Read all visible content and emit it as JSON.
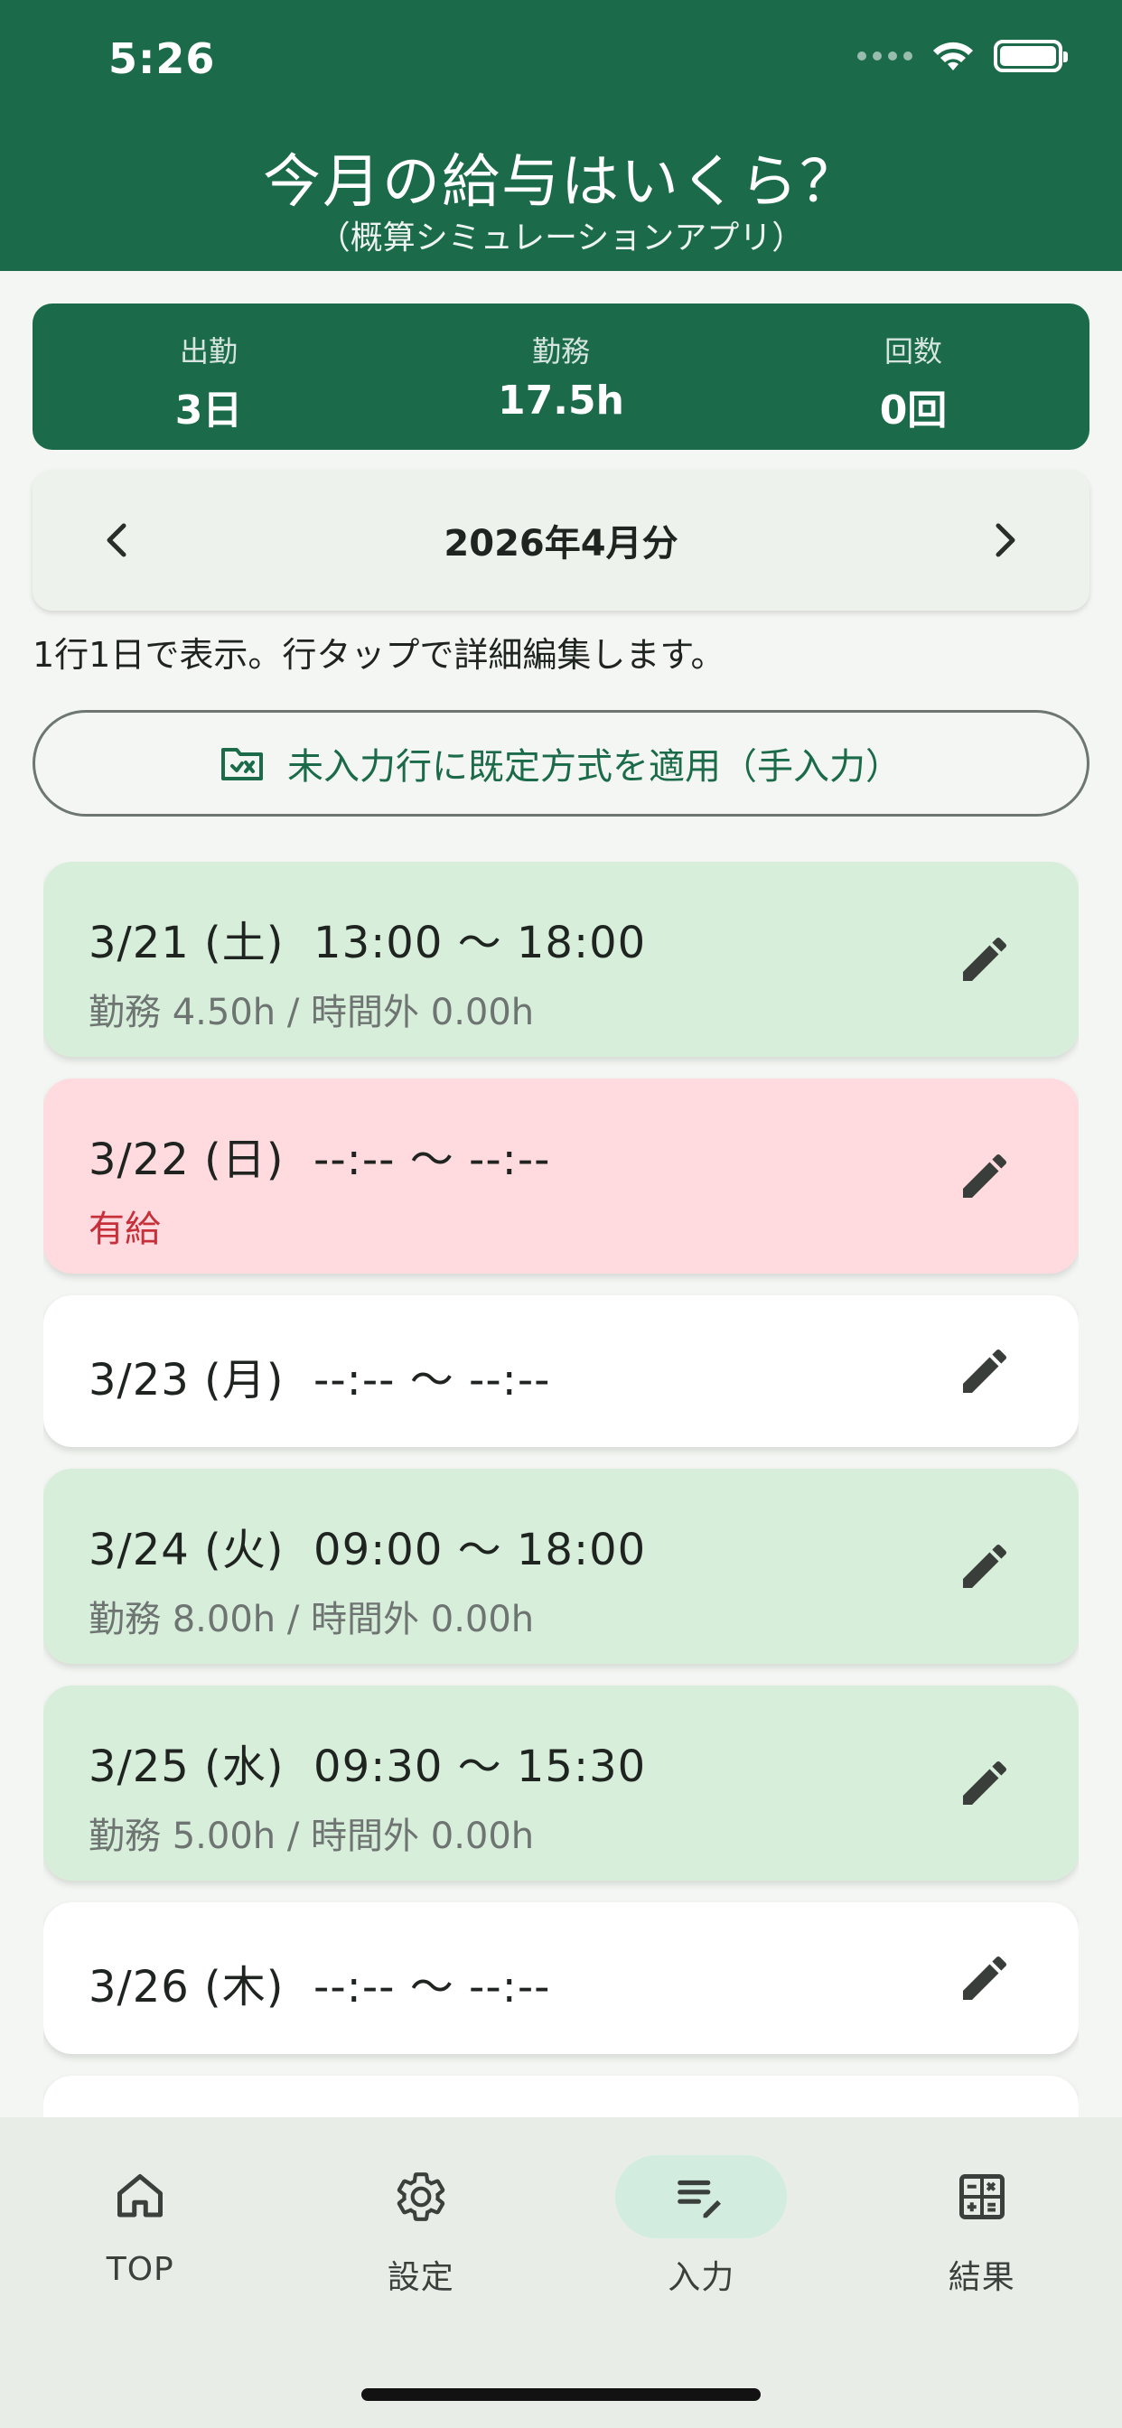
{
  "status": {
    "time": "5:26"
  },
  "header": {
    "title": "今月の給与はいくら？",
    "subtitle": "（概算シミュレーションアプリ）"
  },
  "summary": [
    {
      "label": "出勤",
      "value": "3日"
    },
    {
      "label": "勤務",
      "value": "17.5h"
    },
    {
      "label": "回数",
      "value": "0回"
    }
  ],
  "month_selector": {
    "label": "2026年4月分"
  },
  "hint": "1行1日で表示。行タップで詳細編集します。",
  "apply_button": {
    "label": "未入力行に既定方式を適用（手入力）",
    "icon": "folder-check-icon"
  },
  "days": [
    {
      "date": "3/21 (土)",
      "time": "13:00 〜 18:00",
      "detail": "勤務 4.50h / 時間外 0.00h",
      "status": "worked"
    },
    {
      "date": "3/22 (日)",
      "time": "--:-- 〜 --:--",
      "detail": "有給",
      "status": "paid-leave"
    },
    {
      "date": "3/23 (月)",
      "time": "--:-- 〜 --:--",
      "detail": "",
      "status": "empty"
    },
    {
      "date": "3/24 (火)",
      "time": "09:00 〜 18:00",
      "detail": "勤務 8.00h / 時間外 0.00h",
      "status": "worked"
    },
    {
      "date": "3/25 (水)",
      "time": "09:30 〜 15:30",
      "detail": "勤務 5.00h / 時間外 0.00h",
      "status": "worked"
    },
    {
      "date": "3/26 (木)",
      "time": "--:-- 〜 --:--",
      "detail": "",
      "status": "empty"
    }
  ],
  "nav": [
    {
      "label": "TOP",
      "icon": "home-icon",
      "active": false
    },
    {
      "label": "設定",
      "icon": "gear-icon",
      "active": false
    },
    {
      "label": "入力",
      "icon": "edit-list-icon",
      "active": true
    },
    {
      "label": "結果",
      "icon": "calculator-icon",
      "active": false
    }
  ],
  "colors": {
    "brand": "#1b6b4a",
    "worked_bg": "#d7efda",
    "leave_bg": "#ffdadf",
    "leave_text": "#c6303a"
  }
}
